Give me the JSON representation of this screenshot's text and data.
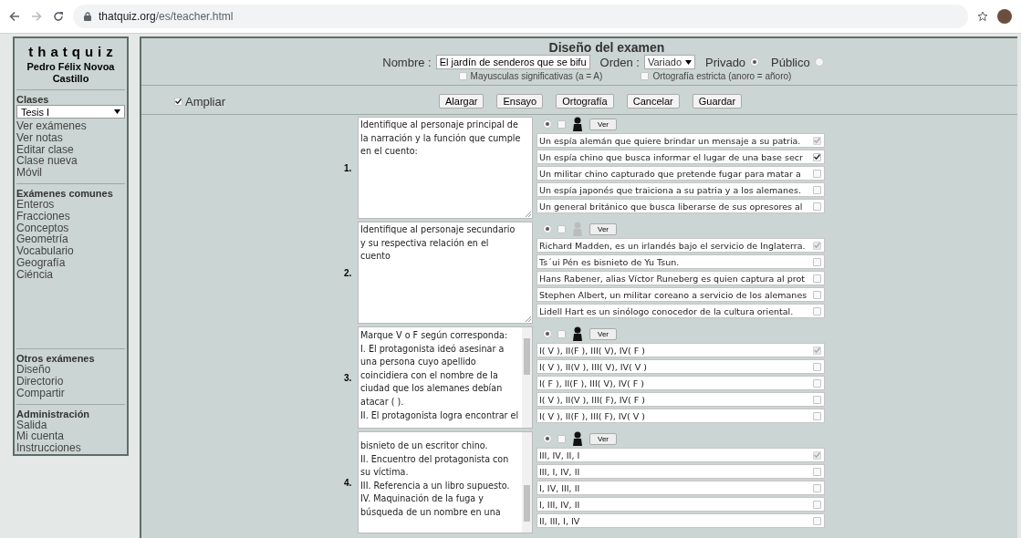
{
  "browser": {
    "url_host": "thatquiz.org",
    "url_path": "/es/teacher.html"
  },
  "sidebar": {
    "brand": "thatquiz",
    "teacher": "Pedro Félix Novoa Castillo",
    "class_label": "Clases",
    "class_value": "Tesis I",
    "sections": [
      {
        "items": [
          "Ver exámenes",
          "Ver notas",
          "Editar clase",
          "Clase nueva",
          "Móvil"
        ]
      },
      {
        "heading": "Exámenes comunes",
        "items": [
          "Enteros",
          "Fracciones",
          "Conceptos",
          "Geometría",
          "Vocabulario",
          "Geografía",
          "Ciéncia"
        ]
      },
      {
        "heading": "Otros exámenes",
        "items": [
          "Diseño",
          "Directorio",
          "Compartir"
        ]
      },
      {
        "heading": "Administración",
        "items": [
          "Salida",
          "Mi cuenta",
          "Instrucciones"
        ]
      }
    ]
  },
  "exam": {
    "title": "Diseño del examen",
    "name_label": "Nombre :",
    "name_value": "El jardín de senderos que se bifu",
    "order_label": "Orden :",
    "order_value": "Variado",
    "visibility": [
      {
        "label": "Privado",
        "selected": true
      },
      {
        "label": "Público",
        "selected": false
      }
    ],
    "options": [
      {
        "label": "Mayusculas significativas (a = A)",
        "checked": false
      },
      {
        "label": "Ortografía estricta (anoro = añoro)",
        "checked": false
      }
    ]
  },
  "toolbar": {
    "expand": {
      "label": "Ampliar",
      "checked": true
    },
    "buttons": [
      "Alargar",
      "Ensayo",
      "Ortografía",
      "Cancelar",
      "Guardar"
    ]
  },
  "questions": [
    {
      "number": "1.",
      "text": "Identifique al personaje principal de la narración y la función que cumple en el cuento:",
      "radio_on": true,
      "flag_checked": false,
      "figure_dimmed": false,
      "view_button": "Ver",
      "answers": [
        {
          "text": "Un espía alemán que quiere brindar un mensaje a su patria.",
          "checked": true,
          "disabled": true
        },
        {
          "text": "Un espía chino que busca informar el lugar de una base secr",
          "checked": true,
          "disabled": false
        },
        {
          "text": "Un militar chino capturado que pretende fugar para matar a",
          "checked": false,
          "disabled": false
        },
        {
          "text": "Un espía japonés que traiciona a su patria y a los alemanes.",
          "checked": false,
          "disabled": false
        },
        {
          "text": "Un general británico que busca liberarse de sus opresores al",
          "checked": false,
          "disabled": false
        }
      ]
    },
    {
      "number": "2.",
      "text": "Identifique al personaje secundario y su respectiva relación en el cuento",
      "radio_on": true,
      "flag_checked": false,
      "figure_dimmed": true,
      "view_button": "Ver",
      "answers": [
        {
          "text": "Richard Madden, es un irlandés bajo el servicio de Inglaterra.",
          "checked": true,
          "disabled": true
        },
        {
          "text": "Ts´ui Pén es bisnieto de Yu Tsun.",
          "checked": false,
          "disabled": false
        },
        {
          "text": "Hans Rabener, alias Víctor Runeberg es quien captura al prot",
          "checked": false,
          "disabled": false
        },
        {
          "text": "Stephen Albert, un militar coreano a servicio de los alemanes",
          "checked": false,
          "disabled": false
        },
        {
          "text": "Lidell Hart es un sinólogo conocedor de la cultura oriental.",
          "checked": false,
          "disabled": false
        }
      ]
    },
    {
      "number": "3.",
      "text": "Marque V o F según corresponda:\nI. El protagonista ideó asesinar a una persona cuyo apellido coincidiera con el nombre de la ciudad que los alemanes debían atacar ( ).\nII. El protagonista logra encontrar el",
      "radio_on": true,
      "flag_checked": false,
      "figure_dimmed": false,
      "view_button": "Ver",
      "scrollbar": true,
      "scrolled_down": false,
      "answers": [
        {
          "text": "I( V ), II(F ), III( V), IV( F )",
          "checked": true,
          "disabled": true
        },
        {
          "text": "I( V ), II(V ), III( V), IV( V )",
          "checked": false,
          "disabled": false
        },
        {
          "text": "I( F ), II(F ), III( V), IV( F )",
          "checked": false,
          "disabled": false
        },
        {
          "text": "I( V ), II(V ), III( F), IV( F )",
          "checked": false,
          "disabled": false
        },
        {
          "text": "I( V ), II(F ), III( F), IV( V )",
          "checked": false,
          "disabled": false
        }
      ]
    },
    {
      "number": "4.",
      "text": "bisnieto de un escritor chino.\nII. Encuentro del protagonista con su víctima.\nIII. Referencia a un libro supuesto.\nIV. Maquinación de la fuga y búsqueda de un nombre en una",
      "radio_on": true,
      "flag_checked": false,
      "figure_dimmed": false,
      "view_button": "Ver",
      "scrollbar": true,
      "scrolled_down": true,
      "answers": [
        {
          "text": "III, IV, II, I",
          "checked": true,
          "disabled": true
        },
        {
          "text": "III, I, IV, II",
          "checked": false,
          "disabled": false
        },
        {
          "text": "I, IV, III, II",
          "checked": false,
          "disabled": false
        },
        {
          "text": "I, III, IV, II",
          "checked": false,
          "disabled": false
        },
        {
          "text": "II, III, I, IV",
          "checked": false,
          "disabled": false
        }
      ]
    }
  ]
}
